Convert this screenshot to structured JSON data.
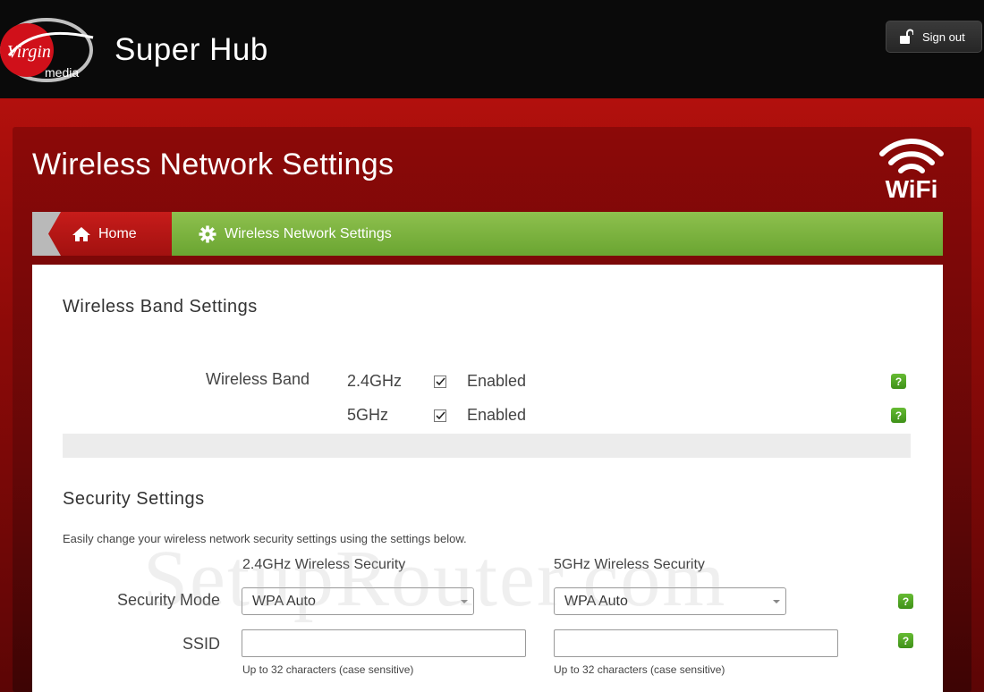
{
  "header": {
    "logo_text": "Virgin media",
    "app_title": "Super Hub",
    "signout_label": "Sign out"
  },
  "page": {
    "title": "Wireless Network Settings",
    "wifi_logo_text": "WiFi"
  },
  "breadcrumb": {
    "home": "Home",
    "current": "Wireless Network Settings"
  },
  "band_settings": {
    "heading": "Wireless Band Settings",
    "label": "Wireless Band",
    "bands": [
      {
        "name": "2.4GHz",
        "checked": true,
        "status": "Enabled"
      },
      {
        "name": "5GHz",
        "checked": true,
        "status": "Enabled"
      }
    ],
    "help": "?"
  },
  "security": {
    "heading": "Security Settings",
    "description": "Easily change your wireless network security settings using the settings below.",
    "col_24": "2.4GHz Wireless Security",
    "col_5": "5GHz Wireless Security",
    "mode_label": "Security Mode",
    "mode_24": "WPA Auto",
    "mode_5": "WPA Auto",
    "ssid_label": "SSID",
    "ssid_24": "",
    "ssid_5": "",
    "ssid_hint_24": "Up to 32 characters (case sensitive)",
    "ssid_hint_5": "Up to 32 characters (case sensitive)",
    "help": "?"
  },
  "watermark": "SetupRouter.com",
  "colors": {
    "brand_red": "#b2100d",
    "breadcrumb_green": "#7cb342",
    "help_green": "#4fa322"
  }
}
